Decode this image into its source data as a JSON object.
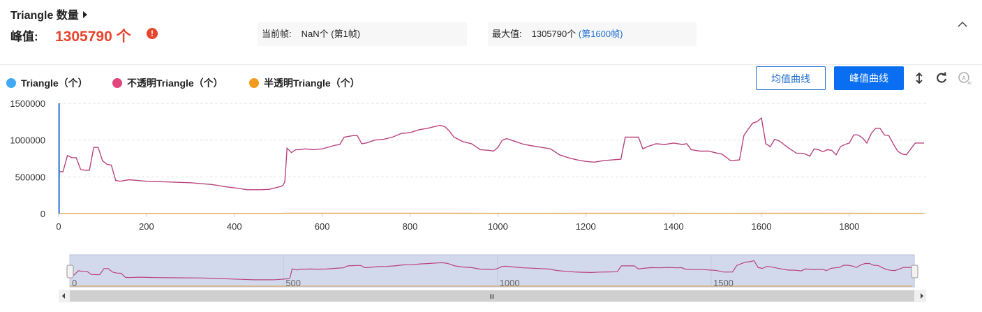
{
  "header": {
    "title": "Triangle 数量",
    "peak_label": "峰值:",
    "peak_value": "1305790 个",
    "current_label": "当前帧:",
    "current_value": "NaN个 (第1帧)",
    "max_label": "最大值:",
    "max_value": "1305790个",
    "max_frame_link": "(第1600帧)"
  },
  "legend": [
    {
      "label": "Triangle（个）",
      "color": "#3fa9f5"
    },
    {
      "label": "不透明Triangle（个）",
      "color": "#e0457b"
    },
    {
      "label": "半透明Triangle（个）",
      "color": "#f39a1e"
    }
  ],
  "buttons": {
    "mean_curve": "均值曲线",
    "peak_curve": "峰值曲线"
  },
  "toolbar_icons": [
    "vertical-resize-icon",
    "refresh-icon",
    "ai-icon"
  ],
  "chart_data": {
    "type": "line",
    "xlim": [
      0,
      1975
    ],
    "ylim": [
      0,
      1500000
    ],
    "x_ticks": [
      "0",
      "200",
      "400",
      "600",
      "800",
      "1000",
      "1200",
      "1400",
      "1600",
      "1800"
    ],
    "y_ticks": [
      "0",
      "500000",
      "1000000",
      "1500000"
    ],
    "grid": true,
    "series": [
      {
        "name": "不透明Triangle（个）",
        "color": "#b9437f",
        "x": [
          0,
          10,
          20,
          30,
          40,
          50,
          60,
          70,
          80,
          90,
          100,
          110,
          120,
          130,
          140,
          160,
          180,
          200,
          250,
          300,
          350,
          380,
          400,
          430,
          460,
          480,
          500,
          510,
          515,
          520,
          530,
          540,
          550,
          560,
          580,
          600,
          630,
          640,
          650,
          660,
          670,
          680,
          690,
          700,
          720,
          740,
          760,
          780,
          800,
          820,
          840,
          860,
          870,
          880,
          890,
          900,
          920,
          940,
          960,
          980,
          990,
          1000,
          1010,
          1020,
          1040,
          1060,
          1080,
          1100,
          1120,
          1140,
          1160,
          1180,
          1200,
          1220,
          1240,
          1260,
          1280,
          1290,
          1300,
          1320,
          1330,
          1340,
          1360,
          1380,
          1400,
          1420,
          1430,
          1440,
          1460,
          1480,
          1500,
          1510,
          1530,
          1550,
          1560,
          1570,
          1580,
          1590,
          1600,
          1610,
          1620,
          1630,
          1640,
          1660,
          1680,
          1690,
          1700,
          1710,
          1720,
          1730,
          1740,
          1750,
          1760,
          1770,
          1780,
          1790,
          1800,
          1810,
          1820,
          1830,
          1840,
          1850,
          1860,
          1870,
          1880,
          1890,
          1900,
          1910,
          1920,
          1930,
          1940,
          1950,
          1960,
          1970
        ],
        "y": [
          570000,
          570000,
          790000,
          760000,
          760000,
          600000,
          590000,
          590000,
          900000,
          900000,
          720000,
          670000,
          660000,
          450000,
          440000,
          460000,
          450000,
          440000,
          430000,
          420000,
          395000,
          365000,
          350000,
          325000,
          325000,
          330000,
          360000,
          380000,
          430000,
          890000,
          830000,
          870000,
          870000,
          880000,
          870000,
          880000,
          930000,
          940000,
          1040000,
          1050000,
          1060000,
          1060000,
          950000,
          960000,
          1000000,
          1010000,
          1040000,
          1090000,
          1100000,
          1140000,
          1160000,
          1190000,
          1200000,
          1180000,
          1120000,
          1040000,
          980000,
          950000,
          870000,
          860000,
          850000,
          900000,
          1000000,
          1020000,
          980000,
          940000,
          920000,
          900000,
          880000,
          800000,
          760000,
          730000,
          710000,
          700000,
          720000,
          730000,
          740000,
          1040000,
          1040000,
          1040000,
          880000,
          910000,
          950000,
          940000,
          960000,
          940000,
          950000,
          870000,
          850000,
          850000,
          820000,
          810000,
          720000,
          730000,
          1060000,
          1150000,
          1230000,
          1250000,
          1300000,
          950000,
          910000,
          1010000,
          990000,
          900000,
          820000,
          820000,
          810000,
          780000,
          880000,
          870000,
          840000,
          870000,
          860000,
          800000,
          910000,
          940000,
          960000,
          1070000,
          1070000,
          1030000,
          960000,
          1090000,
          1160000,
          1160000,
          1070000,
          1060000,
          950000,
          850000,
          810000,
          800000,
          880000,
          960000,
          960000,
          960000
        ]
      },
      {
        "name": "半透明Triangle（个）",
        "color": "#e8b060",
        "x": [
          0,
          500,
          520,
          900,
          1000,
          1300,
          1500,
          1700,
          1970
        ],
        "y": [
          3000,
          3000,
          6000,
          6000,
          4000,
          5000,
          4000,
          5000,
          4000
        ]
      },
      {
        "name": "Triangle（个）",
        "color": "#1f6fd0",
        "x": [
          1
        ],
        "y": [
          1500000
        ]
      }
    ],
    "navigator": {
      "x_ticks": [
        "0",
        "500",
        "1000",
        "1500"
      ],
      "handle_label": "III"
    }
  }
}
